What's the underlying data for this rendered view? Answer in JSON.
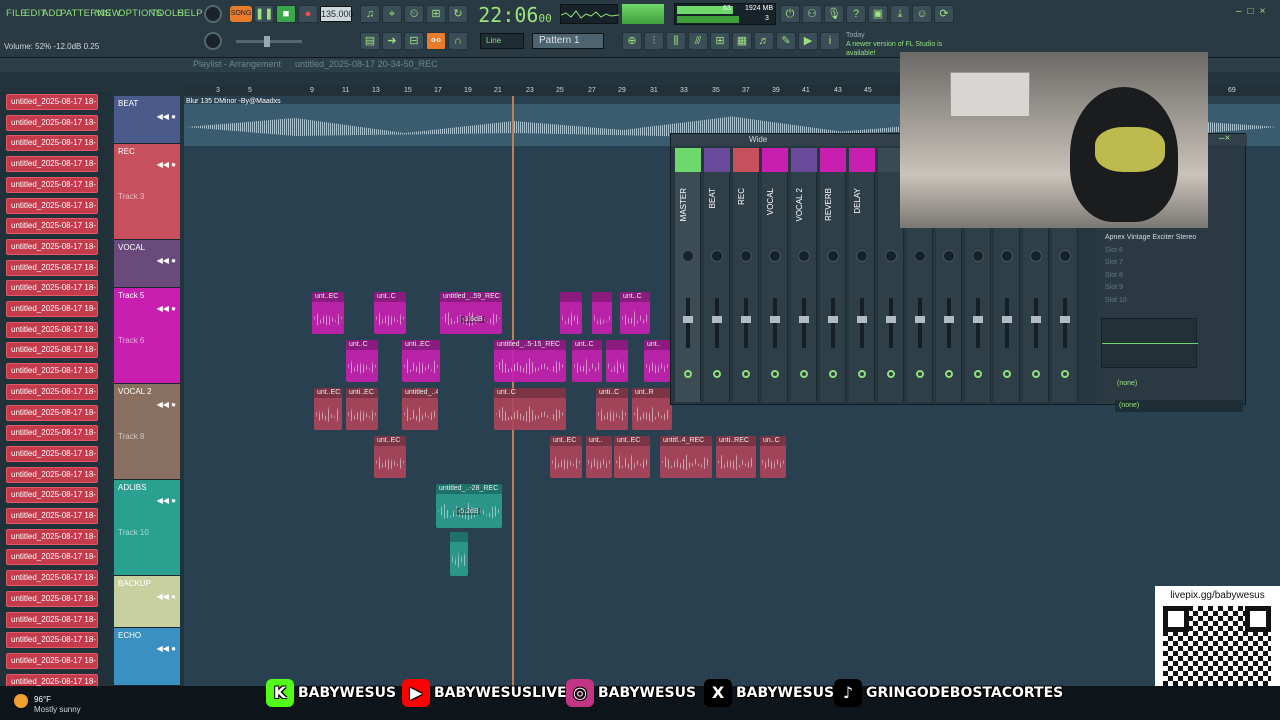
{
  "menu": [
    "FILE",
    "EDIT",
    "ADD",
    "PATTERNS",
    "VIEW",
    "OPTIONS",
    "TOOLS",
    "HELP"
  ],
  "transport": {
    "mode": "SONG",
    "tempo": "135.000",
    "clock": "22:06",
    "clock_sub": "00",
    "cpu": "63",
    "ram": "1924 MB",
    "voices": "3"
  },
  "hint": {
    "volume": "Volume: 52% -12.0dB 0.25",
    "news": "A newer version of FL Studio is available!",
    "today": "Today"
  },
  "toolbar2": {
    "snap": "Line",
    "pattern": "Pattern 1"
  },
  "playlist": {
    "title": "Playlist - Arrangement",
    "file": "untitled_2025-08-17 20-34-50_REC",
    "beat_label": "Blur 135 DMinor -By@Maadxs",
    "ruler": [
      "3",
      "5",
      "9",
      "11",
      "13",
      "15",
      "17",
      "19",
      "21",
      "23",
      "25",
      "27",
      "29",
      "31",
      "33",
      "35",
      "37",
      "39",
      "41",
      "43",
      "45",
      "69"
    ]
  },
  "browser_items": [
    "untitled_2025-08-17 18-",
    "untitled_2025-08-17 18-",
    "untitled_2025-08-17 18-",
    "untitled_2025-08-17 18-",
    "untitled_2025-08-17 18-",
    "untitled_2025-08-17 18-",
    "untitled_2025-08-17 18-",
    "untitled_2025-08-17 18-",
    "untitled_2025-08-17 18-",
    "untitled_2025-08-17 18-",
    "untitled_2025-08-17 18-",
    "untitled_2025-08-17 18-",
    "untitled_2025-08-17 18-",
    "untitled_2025-08-17 18-",
    "untitled_2025-08-17 18-",
    "untitled_2025-08-17 18-",
    "untitled_2025-08-17 18-",
    "untitled_2025-08-17 18-",
    "untitled_2025-08-17 18-",
    "untitled_2025-08-17 18-",
    "untitled_2025-08-17 18-",
    "untitled_2025-08-17 18-",
    "untitled_2025-08-17 18-",
    "untitled_2025-08-17 18-",
    "untitled_2025-08-17 18-",
    "untitled_2025-08-17 18-",
    "untitled_2025-08-17 18-",
    "untitled_2025-08-17 18-",
    "untitled_2025-08-17 18-"
  ],
  "tracks": [
    {
      "name": "BEAT",
      "sub": "",
      "color": "#4a5a8a"
    },
    {
      "name": "REC",
      "sub": "Track 3",
      "color": "#c8505c"
    },
    {
      "name": "VOCAL",
      "sub": "",
      "color": "#6a4a7a"
    },
    {
      "name": "Track 5",
      "sub": "Track 6",
      "color": "#c81fb0"
    },
    {
      "name": "VOCAL 2",
      "sub": "Track 8",
      "color": "#8a7060"
    },
    {
      "name": "ADLIBS",
      "sub": "Track 10",
      "color": "#2aa090"
    },
    {
      "name": "BACKUP",
      "sub": "",
      "color": "#c8d0a0"
    },
    {
      "name": "ECHO",
      "sub": "",
      "color": "#3a90c0"
    }
  ],
  "clips": [
    {
      "label": "unt..EC",
      "db": ""
    },
    {
      "label": "unt..C",
      "db": ""
    },
    {
      "label": "untitled_..59_REC",
      "db": "-3.6dB"
    },
    {
      "label": "",
      "db": ""
    },
    {
      "label": "",
      "db": ""
    },
    {
      "label": "unt..C",
      "db": ""
    },
    {
      "label": "unt..C",
      "db": ""
    },
    {
      "label": "unti..EC",
      "db": ""
    },
    {
      "label": "untitled_..5-15_REC",
      "db": ""
    },
    {
      "label": "unt..C",
      "db": ""
    },
    {
      "label": "",
      "db": ""
    },
    {
      "label": "unt..",
      "db": ""
    },
    {
      "label": "unt..EC",
      "db": ""
    },
    {
      "label": "unti..EC",
      "db": ""
    },
    {
      "label": "untitled_..4-27_REC",
      "db": ""
    },
    {
      "label": "unt..C",
      "db": ""
    },
    {
      "label": "unti..C",
      "db": ""
    },
    {
      "label": "unt..R",
      "db": ""
    },
    {
      "label": "unt..EC",
      "db": ""
    },
    {
      "label": "unt..EC",
      "db": ""
    },
    {
      "label": "unt..",
      "db": ""
    },
    {
      "label": "unt..EC",
      "db": ""
    },
    {
      "label": "untitl..4_REC",
      "db": ""
    },
    {
      "label": "unti..REC",
      "db": ""
    },
    {
      "label": "un..C",
      "db": ""
    },
    {
      "label": "untitled_..-28_REC",
      "db": "-5.2dB"
    },
    {
      "label": "",
      "db": ""
    }
  ],
  "mixer": {
    "title": "Wide",
    "strips": [
      "MASTER",
      "BEAT",
      "REC",
      "VOCAL",
      "VOCAL 2",
      "REVERB",
      "DELAY"
    ],
    "slots": [
      "Apnex Vintage Exciter Stereo",
      "Slot 6",
      "Slot 7",
      "Slot 8",
      "Slot 9",
      "Slot 10"
    ],
    "none1": "(none)",
    "none2": "(none)"
  },
  "overlay": {
    "qr_url": "livepix.gg/babywesus",
    "weather_temp": "96°F",
    "weather_desc": "Mostly sunny"
  },
  "socials": [
    {
      "icon": "kick-icon",
      "name": "BABYWESUS",
      "color": "#53fc18"
    },
    {
      "icon": "youtube-icon",
      "name": "BABYWESUSLIVE",
      "color": "#ff0000"
    },
    {
      "icon": "instagram-icon",
      "name": "BABYWESUS",
      "color": "#c13584"
    },
    {
      "icon": "x-icon",
      "name": "BABYWESUS",
      "color": "#000000"
    },
    {
      "icon": "tiktok-icon",
      "name": "GRINGODEBOSTACORTES",
      "color": "#000000"
    }
  ]
}
